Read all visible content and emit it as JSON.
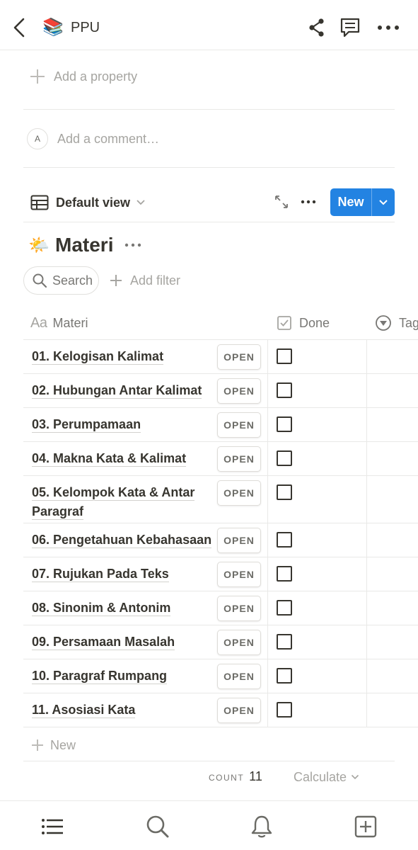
{
  "topbar": {
    "page_icon": "📚",
    "title": "PPU"
  },
  "properties": {
    "add_property_label": "Add a property"
  },
  "comment": {
    "avatar_initial": "A",
    "placeholder": "Add a comment…"
  },
  "view": {
    "name": "Default view",
    "new_label": "New"
  },
  "database": {
    "icon": "🌤️",
    "title": "Materi",
    "search_label": "Search",
    "add_filter_label": "Add filter",
    "columns": {
      "name": "Materi",
      "done": "Done",
      "tags": "Tag"
    },
    "open_label": "OPEN",
    "rows": [
      {
        "name": "01. Kelogisan Kalimat",
        "done": false
      },
      {
        "name": "02. Hubungan Antar Kalimat",
        "done": false
      },
      {
        "name": "03. Perumpamaan",
        "done": false
      },
      {
        "name": "04. Makna Kata & Kalimat",
        "done": false
      },
      {
        "name": "05. Kelompok Kata & Antar Paragraf",
        "done": false
      },
      {
        "name": "06. Pengetahuan Kebahasaan",
        "done": false
      },
      {
        "name": "07. Rujukan Pada Teks",
        "done": false
      },
      {
        "name": "08. Sinonim & Antonim",
        "done": false
      },
      {
        "name": "09. Persamaan Masalah",
        "done": false
      },
      {
        "name": "10. Paragraf Rumpang",
        "done": false
      },
      {
        "name": "11. Asosiasi Kata",
        "done": false
      }
    ],
    "new_row_label": "New",
    "count_label": "COUNT",
    "count_value": "11",
    "calculate_label": "Calculate"
  },
  "colors": {
    "accent": "#2383e2",
    "text": "#37352f",
    "muted": "#a6a5a1",
    "border": "#e9e9e7"
  },
  "icons": {
    "back": "chevron-left-icon",
    "share": "share-icon",
    "comments": "comment-icon",
    "more": "more-horizontal-icon",
    "table": "table-icon",
    "expand": "expand-icon",
    "bottom_nav": [
      "list-icon",
      "search-icon",
      "bell-icon",
      "new-page-icon"
    ]
  }
}
